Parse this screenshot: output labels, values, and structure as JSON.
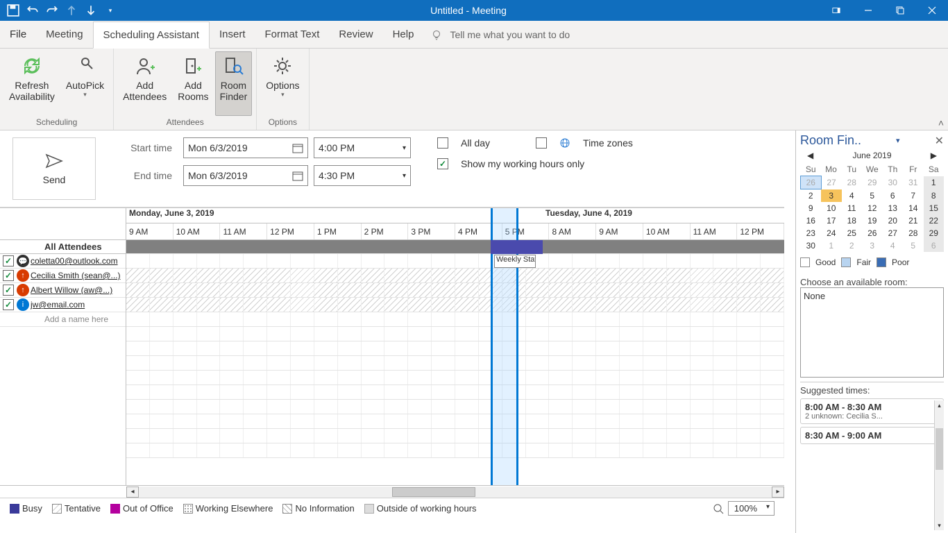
{
  "titlebar": {
    "title": "Untitled  -  Meeting"
  },
  "tabs": {
    "file": "File",
    "meeting": "Meeting",
    "scheduling": "Scheduling Assistant",
    "insert": "Insert",
    "format": "Format Text",
    "review": "Review",
    "help": "Help",
    "tell_me": "Tell me what you want to do"
  },
  "ribbon": {
    "refresh": "Refresh\nAvailability",
    "autopick": "AutoPick",
    "add_attendees": "Add\nAttendees",
    "add_rooms": "Add\nRooms",
    "room_finder": "Room\nFinder",
    "options": "Options",
    "group_scheduling": "Scheduling",
    "group_attendees": "Attendees",
    "group_options": "Options"
  },
  "form": {
    "send": "Send",
    "start_label": "Start time",
    "end_label": "End time",
    "start_date": "Mon 6/3/2019",
    "end_date": "Mon 6/3/2019",
    "start_time": "4:00 PM",
    "end_time": "4:30 PM",
    "all_day": "All day",
    "time_zones": "Time zones",
    "working_hours": "Show my working hours only"
  },
  "schedule": {
    "day1": "Monday, June 3, 2019",
    "day2": "Tuesday, June 4, 2019",
    "hours": [
      "9 AM",
      "10 AM",
      "11 AM",
      "12 PM",
      "1 PM",
      "2 PM",
      "3 PM",
      "4 PM",
      "5 PM",
      "8 AM",
      "9 AM",
      "10 AM",
      "11 AM",
      "12 PM"
    ],
    "all_attendees": "All Attendees",
    "attendees": [
      {
        "email": "coletta00@outlook.com",
        "pres": "org"
      },
      {
        "email": "Cecilia Smith (sean@...)",
        "pres": "req"
      },
      {
        "email": "Albert Willow (aw@...)",
        "pres": "req"
      },
      {
        "email": "jw@email.com",
        "pres": "info"
      }
    ],
    "add_name": "Add a name here",
    "event_label": "Weekly Staff"
  },
  "legend": {
    "busy": "Busy",
    "tentative": "Tentative",
    "ooo": "Out of Office",
    "elsewhere": "Working Elsewhere",
    "noinfo": "No Information",
    "outside": "Outside of working hours",
    "zoom": "100%"
  },
  "roomfinder": {
    "title": "Room Fin..",
    "month": "June 2019",
    "dow": [
      "Su",
      "Mo",
      "Tu",
      "We",
      "Th",
      "Fr",
      "Sa"
    ],
    "weeks": [
      [
        {
          "d": "26",
          "o": 1,
          "t": 1
        },
        {
          "d": "27",
          "o": 1
        },
        {
          "d": "28",
          "o": 1
        },
        {
          "d": "29",
          "o": 1
        },
        {
          "d": "30",
          "o": 1
        },
        {
          "d": "31",
          "o": 1
        },
        {
          "d": "1",
          "s": 1
        }
      ],
      [
        {
          "d": "2"
        },
        {
          "d": "3",
          "sel": 1
        },
        {
          "d": "4"
        },
        {
          "d": "5"
        },
        {
          "d": "6"
        },
        {
          "d": "7"
        },
        {
          "d": "8",
          "s": 1
        }
      ],
      [
        {
          "d": "9"
        },
        {
          "d": "10"
        },
        {
          "d": "11"
        },
        {
          "d": "12"
        },
        {
          "d": "13"
        },
        {
          "d": "14"
        },
        {
          "d": "15",
          "s": 1
        }
      ],
      [
        {
          "d": "16"
        },
        {
          "d": "17"
        },
        {
          "d": "18"
        },
        {
          "d": "19"
        },
        {
          "d": "20"
        },
        {
          "d": "21"
        },
        {
          "d": "22",
          "s": 1
        }
      ],
      [
        {
          "d": "23"
        },
        {
          "d": "24"
        },
        {
          "d": "25"
        },
        {
          "d": "26"
        },
        {
          "d": "27"
        },
        {
          "d": "28"
        },
        {
          "d": "29",
          "s": 1
        }
      ],
      [
        {
          "d": "30"
        },
        {
          "d": "1",
          "o": 1
        },
        {
          "d": "2",
          "o": 1
        },
        {
          "d": "3",
          "o": 1
        },
        {
          "d": "4",
          "o": 1
        },
        {
          "d": "5",
          "o": 1
        },
        {
          "d": "6",
          "o": 1,
          "s": 1
        }
      ]
    ],
    "good": "Good",
    "fair": "Fair",
    "poor": "Poor",
    "choose_label": "Choose an available room:",
    "none": "None",
    "suggested_label": "Suggested times:",
    "suggestions": [
      {
        "time": "8:00 AM - 8:30 AM",
        "sub": "2 unknown: Cecilia S..."
      },
      {
        "time": "8:30 AM - 9:00 AM",
        "sub": ""
      }
    ]
  }
}
